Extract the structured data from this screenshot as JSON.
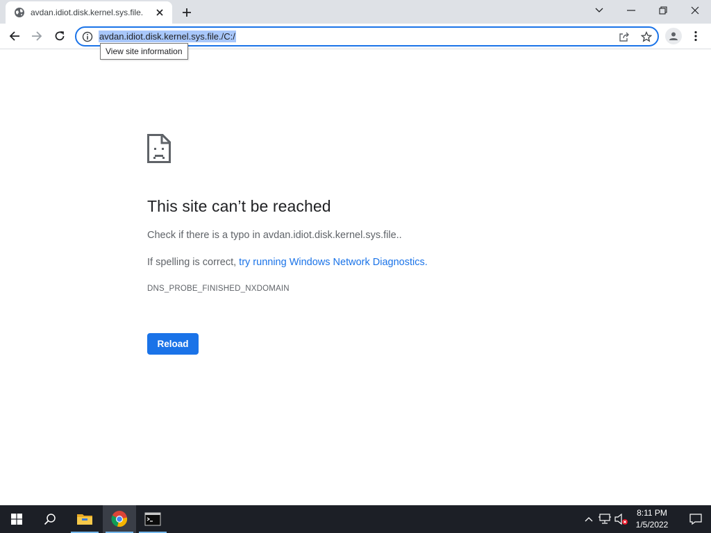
{
  "browser": {
    "tab": {
      "title": "avdan.idiot.disk.kernel.sys.file."
    },
    "address_bar": {
      "url": "avdan.idiot.disk.kernel.sys.file./C:/",
      "tooltip": "View site information"
    },
    "icons": {
      "favicon": "globe-icon",
      "tab_close": "close-icon",
      "new_tab": "plus-icon",
      "tab_search": "chevron-down-icon",
      "minimize": "minimize-icon",
      "restore": "restore-icon",
      "close": "close-icon",
      "back": "back-arrow-icon",
      "forward": "forward-arrow-icon",
      "reload": "reload-icon",
      "site_info": "info-icon",
      "share": "share-icon",
      "bookmark": "star-icon",
      "profile": "person-icon",
      "menu": "kebab-menu-icon"
    }
  },
  "error_page": {
    "icon": "sad-page-icon",
    "title": "This site can’t be reached",
    "line1": "Check if there is a typo in avdan.idiot.disk.kernel.sys.file..",
    "line2_prefix": "If spelling is correct, ",
    "line2_link": "try running Windows Network Diagnostics",
    "line2_suffix": ".",
    "error_code": "DNS_PROBE_FINISHED_NXDOMAIN",
    "reload_label": "Reload"
  },
  "taskbar": {
    "items": [
      {
        "name": "start-icon"
      },
      {
        "name": "search-icon"
      },
      {
        "name": "file-explorer-icon"
      },
      {
        "name": "chrome-icon"
      },
      {
        "name": "command-prompt-icon"
      }
    ],
    "tray": [
      "chevron-up-icon",
      "network-icon",
      "volume-muted-icon"
    ],
    "clock": {
      "time": "8:11 PM",
      "date": "1/5/2022"
    },
    "notifications": "notification-icon"
  },
  "colors": {
    "accent": "#1a73e8",
    "tabstrip": "#dee1e6",
    "taskbar": "#1c1f26",
    "url_selection": "#a8c7fa"
  }
}
